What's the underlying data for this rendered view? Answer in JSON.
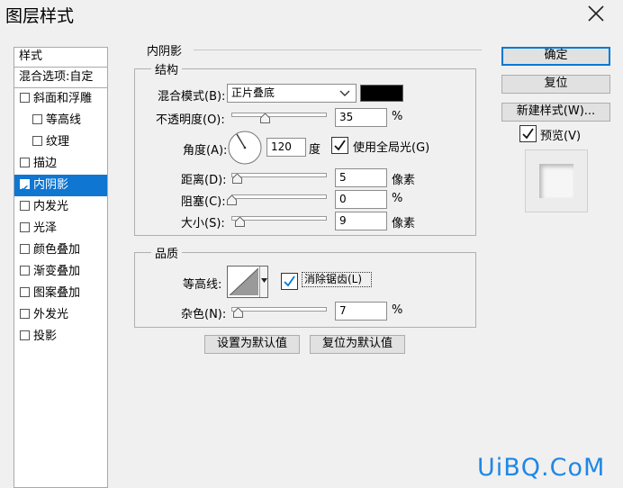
{
  "window": {
    "title": "图层样式"
  },
  "left_panel": {
    "header": "样式",
    "blend_options": "混合选项:自定",
    "items": [
      {
        "label": "斜面和浮雕",
        "checked": false,
        "indent": false,
        "selected": false
      },
      {
        "label": "等高线",
        "checked": false,
        "indent": true,
        "selected": false
      },
      {
        "label": "纹理",
        "checked": false,
        "indent": true,
        "selected": false
      },
      {
        "label": "描边",
        "checked": false,
        "indent": false,
        "selected": false
      },
      {
        "label": "内阴影",
        "checked": true,
        "indent": false,
        "selected": true
      },
      {
        "label": "内发光",
        "checked": false,
        "indent": false,
        "selected": false
      },
      {
        "label": "光泽",
        "checked": false,
        "indent": false,
        "selected": false
      },
      {
        "label": "颜色叠加",
        "checked": false,
        "indent": false,
        "selected": false
      },
      {
        "label": "渐变叠加",
        "checked": false,
        "indent": false,
        "selected": false
      },
      {
        "label": "图案叠加",
        "checked": false,
        "indent": false,
        "selected": false
      },
      {
        "label": "外发光",
        "checked": false,
        "indent": false,
        "selected": false
      },
      {
        "label": "投影",
        "checked": false,
        "indent": false,
        "selected": false
      }
    ]
  },
  "inner_shadow": {
    "section_title": "内阴影",
    "structure": {
      "title": "结构",
      "blend_mode_label": "混合模式(B):",
      "blend_mode_value": "正片叠底",
      "color": "#000000",
      "opacity_label": "不透明度(O):",
      "opacity_value": "35",
      "opacity_unit": "%",
      "opacity_fraction": 0.35,
      "angle_label": "角度(A):",
      "angle_value": "120",
      "angle_unit": "度",
      "global_light_label": "使用全局光(G)",
      "global_light_checked": true,
      "distance_label": "距离(D):",
      "distance_value": "5",
      "distance_unit": "像素",
      "choke_label": "阻塞(C):",
      "choke_value": "0",
      "choke_unit": "%",
      "size_label": "大小(S):",
      "size_value": "9",
      "size_unit": "像素"
    },
    "quality": {
      "title": "品质",
      "contour_label": "等高线:",
      "antialias_label": "消除锯齿(L)",
      "antialias_checked": true,
      "noise_label": "杂色(N):",
      "noise_value": "7",
      "noise_unit": "%"
    },
    "set_default": "设置为默认值",
    "reset_default": "复位为默认值"
  },
  "buttons": {
    "ok": "确定",
    "reset": "复位",
    "new_style": "新建样式(W)...",
    "preview_label": "预览(V)",
    "preview_checked": true
  },
  "watermark": "UiBQ.CoM",
  "colors": {
    "accent": "#0f76d2",
    "primary_border": "#0078d7"
  }
}
